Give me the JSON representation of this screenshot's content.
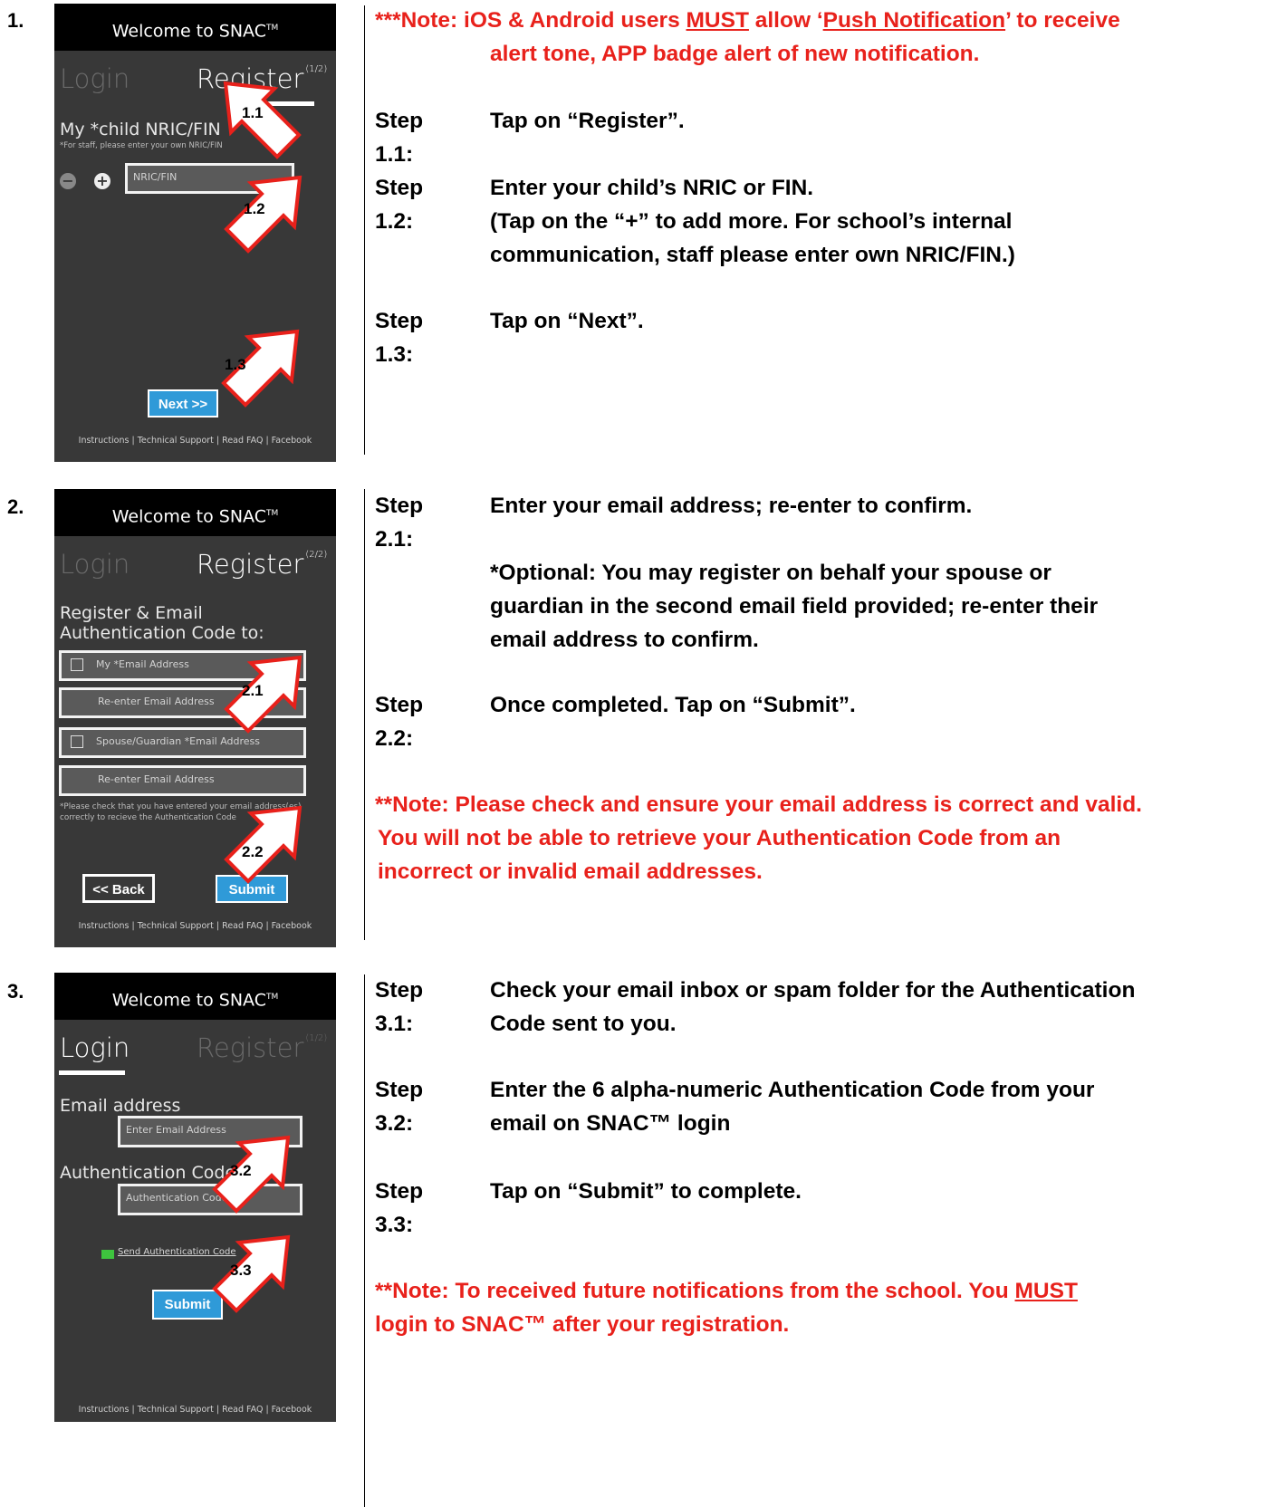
{
  "sections": [
    {
      "number": "1.",
      "screen": {
        "header_title": "Welcome to SNAC",
        "tm": "TM",
        "tab_login": "Login",
        "tab_register": "Register",
        "register_step": "(1/2)",
        "label": "My *child NRIC/FIN",
        "sublabel": "*For staff, please enter your own NRIC/FIN",
        "minus": "−",
        "plus": "+",
        "nric_placeholder": "NRIC/FIN",
        "next_button": "Next >>",
        "footer": "Instructions | Technical Support | Read FAQ | Facebook",
        "callouts": [
          "1.1",
          "1.2",
          "1.3"
        ]
      },
      "note_prefix": "***Note: iOS & Android users ",
      "note_must": "MUST",
      "note_mid1": " allow ‘",
      "note_push": "Push Notification",
      "note_mid2": "’ to receive",
      "note_line2": "alert tone, APP badge alert of new notification.",
      "steps": [
        {
          "key": "Step 1.1:",
          "text": "Tap on “Register”."
        },
        {
          "key": "Step 1.2:",
          "text": "Enter your child’s NRIC or FIN.",
          "extra1": "(Tap on the “+” to add more. For school’s internal",
          "extra2": "communication, staff please enter own NRIC/FIN.)"
        },
        {
          "key": "Step 1.3:",
          "text": "Tap on “Next”."
        }
      ]
    },
    {
      "number": "2.",
      "screen": {
        "header_title": "Welcome to SNAC",
        "tm": "TM",
        "tab_login": "Login",
        "tab_register": "Register",
        "register_step": "(2/2)",
        "label_line1": "Register & Email",
        "label_line2": "Authentication Code to:",
        "field1": "My *Email Address",
        "field2": "Re-enter Email Address",
        "field3": "Spouse/Guardian *Email Address",
        "field4": "Re-enter Email Address",
        "warn_line1": "*Please check that you have entered your email address(es)",
        "warn_line2": "correctly to recieve the Authentication Code",
        "back_button": "<< Back",
        "submit_button": "Submit",
        "footer": "Instructions | Technical Support | Read FAQ | Facebook",
        "callouts": [
          "2.1",
          "2.2"
        ]
      },
      "steps": [
        {
          "key": "Step 2.1:",
          "text": "Enter your email address; re-enter to confirm.",
          "optional1": "*Optional: You may register on behalf your spouse or",
          "optional2": "guardian in the second email field provided; re-enter their",
          "optional3": "email address to confirm."
        },
        {
          "key": "Step 2.2:",
          "text": "Once completed. Tap on “Submit”."
        }
      ],
      "note_line1": "**Note: Please check and ensure your email address is correct and valid.",
      "note_line2": "You will not be able to retrieve your Authentication Code from an",
      "note_line3": "incorrect or invalid email addresses."
    },
    {
      "number": "3.",
      "screen": {
        "header_title": "Welcome to SNAC",
        "tm": "TM",
        "tab_login": "Login",
        "tab_register": "Register",
        "register_step": "(1/2)",
        "email_label": "Email address",
        "email_placeholder": "Enter Email Address",
        "code_label": "Authentication Code",
        "code_placeholder": "Authentication Code",
        "send_link": "Send Authentication Code",
        "submit_button": "Submit",
        "footer": "Instructions | Technical Support | Read FAQ | Facebook",
        "callouts": [
          "3.2",
          "3.3"
        ]
      },
      "steps": [
        {
          "key": "Step 3.1:",
          "text1": "Check your email inbox or spam folder for the Authentication",
          "text2": "Code sent to you."
        },
        {
          "key": "Step 3.2:",
          "text1": "Enter the 6 alpha-numeric Authentication Code from your",
          "text2": "email on SNAC™ login"
        },
        {
          "key": "Step 3.3:",
          "text": "Tap on “Submit” to complete."
        }
      ],
      "note_prefix": "**Note: To received future notifications from the school. You ",
      "note_must": "MUST",
      "note_line2": "login to SNAC™ after your registration."
    }
  ]
}
